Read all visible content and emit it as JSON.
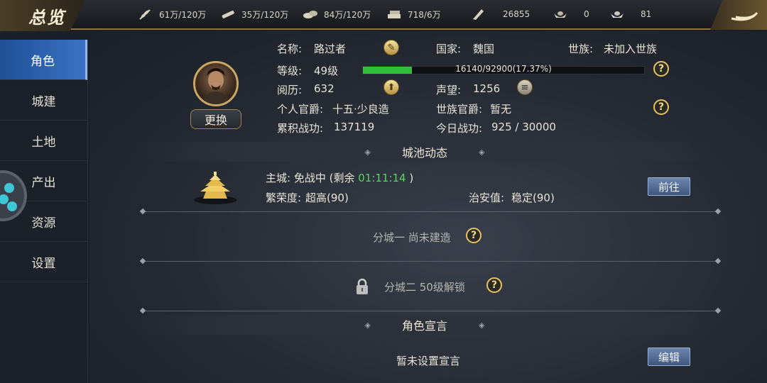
{
  "title": "总览",
  "resources": [
    {
      "icon": "grain-icon",
      "value": "61万/120万"
    },
    {
      "icon": "wood-icon",
      "value": "35万/120万"
    },
    {
      "icon": "stone-icon",
      "value": "84万/120万"
    },
    {
      "icon": "iron-icon",
      "value": "718/6万"
    },
    {
      "icon": "token-icon",
      "value": "26855"
    },
    {
      "icon": "gold-ingot-icon",
      "value": "0"
    },
    {
      "icon": "silver-ingot-icon",
      "value": "81"
    }
  ],
  "sidebar": {
    "items": [
      {
        "label": "角色",
        "active": true
      },
      {
        "label": "城建"
      },
      {
        "label": "土地"
      },
      {
        "label": "产出"
      },
      {
        "label": "资源"
      },
      {
        "label": "设置"
      }
    ]
  },
  "profile": {
    "change_label": "更换",
    "name_label": "名称:",
    "name": "路过者",
    "country_label": "国家:",
    "country": "魏国",
    "clan_label": "世族:",
    "clan": "未加入世族",
    "level_label": "等级:",
    "level": "49级",
    "xp_text": "16140/92900(17.37%)",
    "xp_fraction": 0.1737,
    "exp_label": "阅历:",
    "exp": "632",
    "fame_label": "声望:",
    "fame": "1256",
    "rank_label": "个人官爵:",
    "rank": "十五·少良造",
    "clan_rank_label": "世族官爵:",
    "clan_rank": "暂无",
    "merit_label": "累积战功:",
    "merit": "137119",
    "today_merit_label": "今日战功:",
    "today_merit": "925 / 30000"
  },
  "city": {
    "section_title": "城池动态",
    "main_city_label": "主城: 免战中 (剩余",
    "main_city_timer": "01:11:14",
    "main_city_close": ")",
    "prosperity_label": "繁荣度:",
    "prosperity": "超高(90)",
    "security_label": "治安值:",
    "security": "稳定(90)",
    "goto_label": "前往",
    "branch1": "分城一 尚未建造",
    "branch2": "分城二 50级解锁"
  },
  "declaration": {
    "section_title": "角色宣言",
    "text": "暂未设置宣言",
    "edit_label": "编辑"
  },
  "colors": {
    "accent": "#3b73c4",
    "progress": "#2fbf3a",
    "timer": "#57d65b",
    "gold": "#c8a862"
  }
}
